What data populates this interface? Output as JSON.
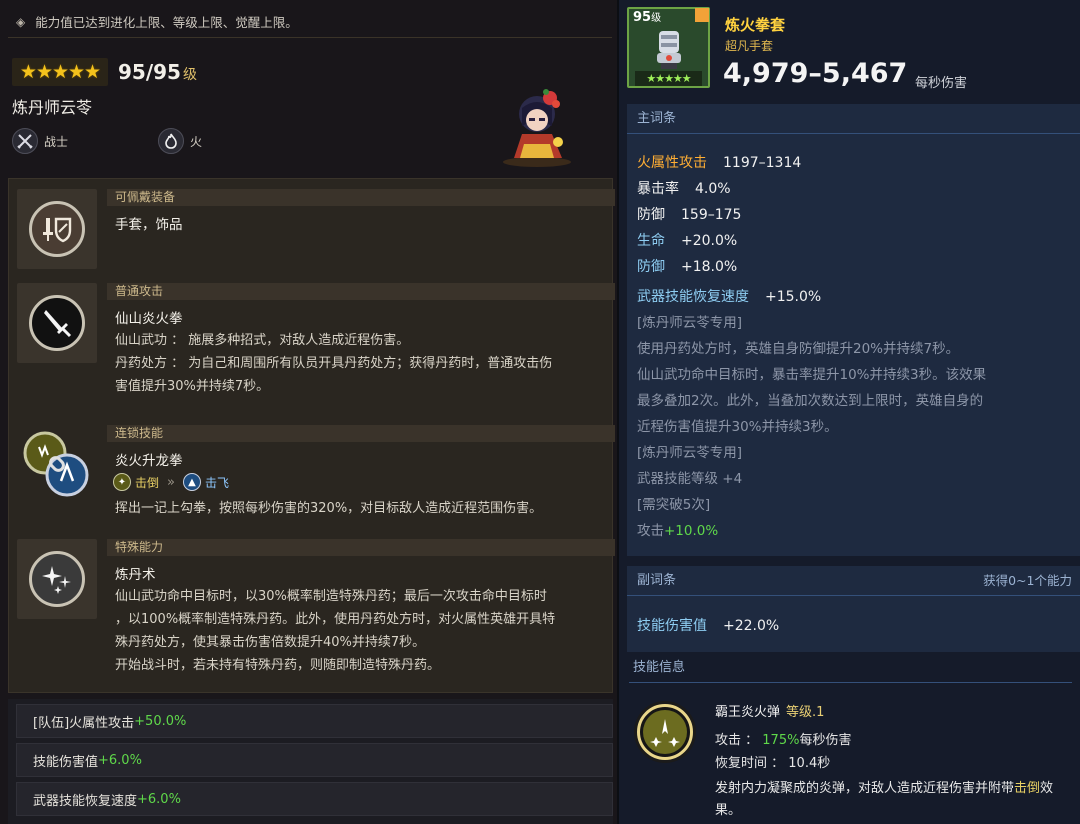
{
  "notice": {
    "text": "能力值已达到进化上限、等级上限、觉醒上限。"
  },
  "hero": {
    "stars": "★★★★★",
    "level_text": "95/95",
    "level_unit": "级",
    "name": "炼丹师云苓",
    "role": "战士",
    "element": "火"
  },
  "skills": [
    {
      "category": "可佩戴装备",
      "title": "手套，饰品",
      "desc": [],
      "icon": "sword-shield-icon"
    },
    {
      "category": "普通攻击",
      "title": "仙山炎火拳",
      "desc": [
        "仙山武功 ： 施展多种招式，对敌人造成近程伤害。",
        "丹药处方 ： 为自己和周围所有队员开具丹药处方；获得丹药时，普通攻击伤",
        "害值提升30%并持续7秒。"
      ],
      "icon": "sword-icon"
    },
    {
      "category": "连锁技能",
      "title": "炎火升龙拳",
      "tag_from": "击倒",
      "tag_arrow": "»",
      "tag_to": "击飞",
      "desc": [
        "挥出一记上勾拳，按照每秒伤害的320%，对目标敌人造成近程范围伤害。"
      ],
      "icon": "chain-icon"
    },
    {
      "category": "特殊能力",
      "title": "炼丹术",
      "desc": [
        "仙山武功命中目标时，以30%概率制造特殊丹药；最后一次攻击命中目标时",
        "，以100%概率制造特殊丹药。此外，使用丹药处方时，对火属性英雄开具特",
        "殊丹药处方，使其暴击伤害倍数提升40%并持续7秒。",
        "开始战斗时，若未持有特殊丹药，则随即制造特殊丹药。"
      ],
      "icon": "sparkle-icon"
    }
  ],
  "bonuses": [
    {
      "label": "[队伍]火属性攻击",
      "value": "+50.0%"
    },
    {
      "label": "技能伤害值",
      "value": "+6.0%"
    },
    {
      "label": "武器技能恢复速度",
      "value": "+6.0%"
    }
  ],
  "item": {
    "level": "95",
    "level_unit": "级",
    "stars": "★★★★★",
    "name": "炼火拳套",
    "subtype": "超凡手套",
    "dps": "4,979–5,467",
    "dps_label": "每秒伤害"
  },
  "main_stats": {
    "header": "主词条",
    "lines": [
      {
        "key": "火属性攻击",
        "value": "1197–1314"
      },
      {
        "key": "暴击率",
        "value": "4.0%"
      },
      {
        "key": "防御",
        "value": "159–175"
      },
      {
        "key": "生命",
        "value": "+20.0%"
      },
      {
        "key": "防御",
        "value": "+18.0%"
      },
      {
        "key": "武器技能恢复速度",
        "value": "+15.0%"
      }
    ],
    "exclusive_1": "[炼丹师云苓专用]",
    "exclusive_desc": [
      "使用丹药处方时，英雄自身防御提升20%并持续7秒。",
      "仙山武功命中目标时，暴击率提升10%并持续3秒。该效果",
      "最多叠加2次。此外，当叠加次数达到上限时，英雄自身的",
      "近程伤害值提升30%并持续3秒。"
    ],
    "exclusive_2": "[炼丹师云苓专用]",
    "weapon_skill_level": "武器技能等级 +4",
    "breakthrough": "[需突破5次]",
    "attack_label": "攻击",
    "attack_value": "+10.0%"
  },
  "sub_stats": {
    "header": "副词条",
    "hint": "获得0~1个能力",
    "key": "技能伤害值",
    "value": "+22.0%"
  },
  "skill_info": {
    "header": "技能信息",
    "name": "霸王炎火弹",
    "level": "等级.1",
    "attack_label": "攻击 ：",
    "attack_value": "175%",
    "attack_suffix": "每秒伤害",
    "cooldown_label": "恢复时间 ：",
    "cooldown_value": "10.4秒",
    "desc_pre": "发射内力凝聚成的炎弹，对敌人造成近程伤害并附带",
    "desc_hl": "击倒",
    "desc_post": "效果。"
  }
}
